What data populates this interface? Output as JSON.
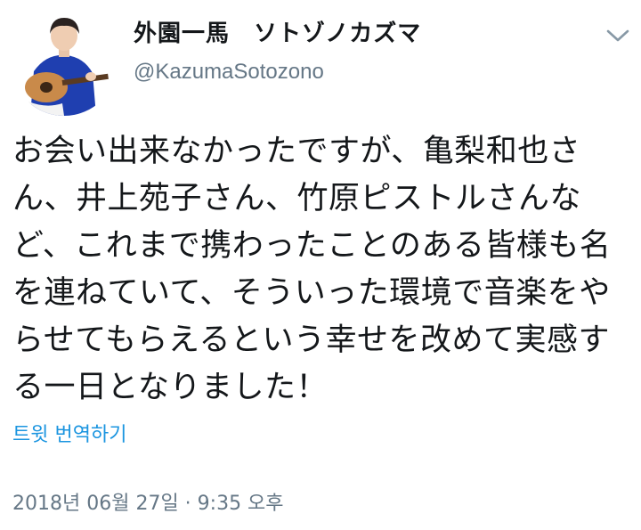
{
  "user": {
    "display_name": "外園一馬　ソトゾノカズマ",
    "handle": "@KazumaSotozono",
    "avatar_icon": "avatar-guitarist-photo"
  },
  "tweet": {
    "text_lines": [
      "お会い出来なかったですが、亀梨和也さ",
      "ん、井上苑子さん、竹原ピストルさんな",
      "ど、これまで携わったことのある皆様も名",
      "を連ねていて、そういった環境で音楽をや",
      "らせてもらえるという幸せを改めて実感す",
      "る一日となりました！"
    ],
    "translate_label": "트윗 번역하기",
    "timestamp": "2018년 06월 27일 · 9:35 오후"
  },
  "menu": {
    "caret_icon": "chevron-down-icon"
  },
  "colors": {
    "text": "#14171a",
    "secondary": "#657786",
    "link": "#1b95e0",
    "caret": "#8899a6"
  }
}
